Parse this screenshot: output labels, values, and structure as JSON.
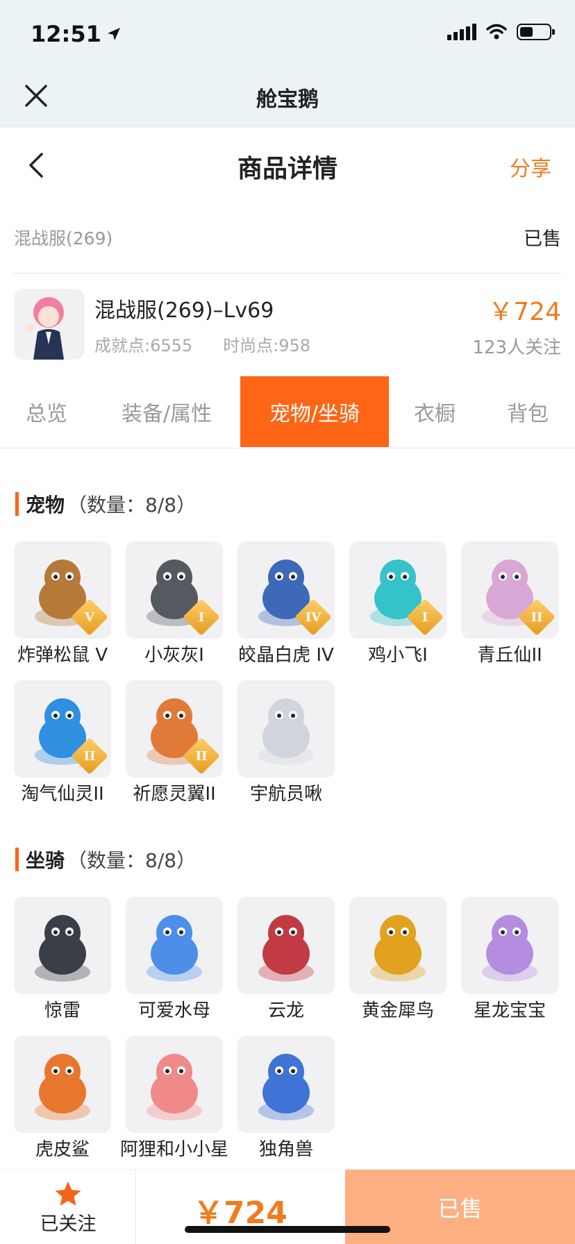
{
  "status": {
    "time": "12:51"
  },
  "miniprogram": {
    "title": "舱宝鹅"
  },
  "nav": {
    "title": "商品详情",
    "share": "分享"
  },
  "server": {
    "name": "混战服(269)",
    "status": "已售"
  },
  "product": {
    "title": "混战服(269)–Lv69",
    "achievement": "成就点:6555",
    "fashion": "时尚点:958",
    "price": "￥724",
    "followers": "123人关注"
  },
  "tabs": [
    "总览",
    "装备/属性",
    "宠物/坐骑",
    "衣橱",
    "背包"
  ],
  "active_tab": "宠物/坐骑",
  "pets": {
    "title": "宠物",
    "count": "（数量：8/8）",
    "items": [
      {
        "name": "炸弹松鼠 V",
        "badge": "V",
        "color": "#b5793a"
      },
      {
        "name": "小灰灰I",
        "badge": "I",
        "color": "#555a60"
      },
      {
        "name": "皎晶白虎 IV",
        "badge": "IV",
        "color": "#3d69b8"
      },
      {
        "name": "鸡小飞I",
        "badge": "I",
        "color": "#35c3c9"
      },
      {
        "name": "青丘仙II",
        "badge": "II",
        "color": "#d9a7d6"
      },
      {
        "name": "淘气仙灵II",
        "badge": "II",
        "color": "#2f8fe0"
      },
      {
        "name": "祈愿灵翼II",
        "badge": "II",
        "color": "#e07a38"
      },
      {
        "name": "宇航员啾",
        "badge": "",
        "color": "#d0d4dc"
      }
    ]
  },
  "mounts": {
    "title": "坐骑",
    "count": "（数量：8/8）",
    "items": [
      {
        "name": "惊雷",
        "color": "#3a3f47"
      },
      {
        "name": "可爱水母",
        "color": "#4d8ee8"
      },
      {
        "name": "云龙",
        "color": "#c23a42"
      },
      {
        "name": "黄金犀鸟",
        "color": "#e0a21f"
      },
      {
        "name": "星龙宝宝",
        "color": "#b48ce0"
      },
      {
        "name": "虎皮鲨",
        "color": "#e8772e"
      },
      {
        "name": "阿狸和小小星",
        "color": "#f08a8a"
      },
      {
        "name": "独角兽",
        "color": "#3f74d6"
      }
    ]
  },
  "bottom": {
    "follow_label": "已关注",
    "price": "￥724",
    "status": "已售"
  },
  "colors": {
    "accent": "#fe6515",
    "price": "#f07c1e",
    "sold_button": "#fcb082"
  }
}
